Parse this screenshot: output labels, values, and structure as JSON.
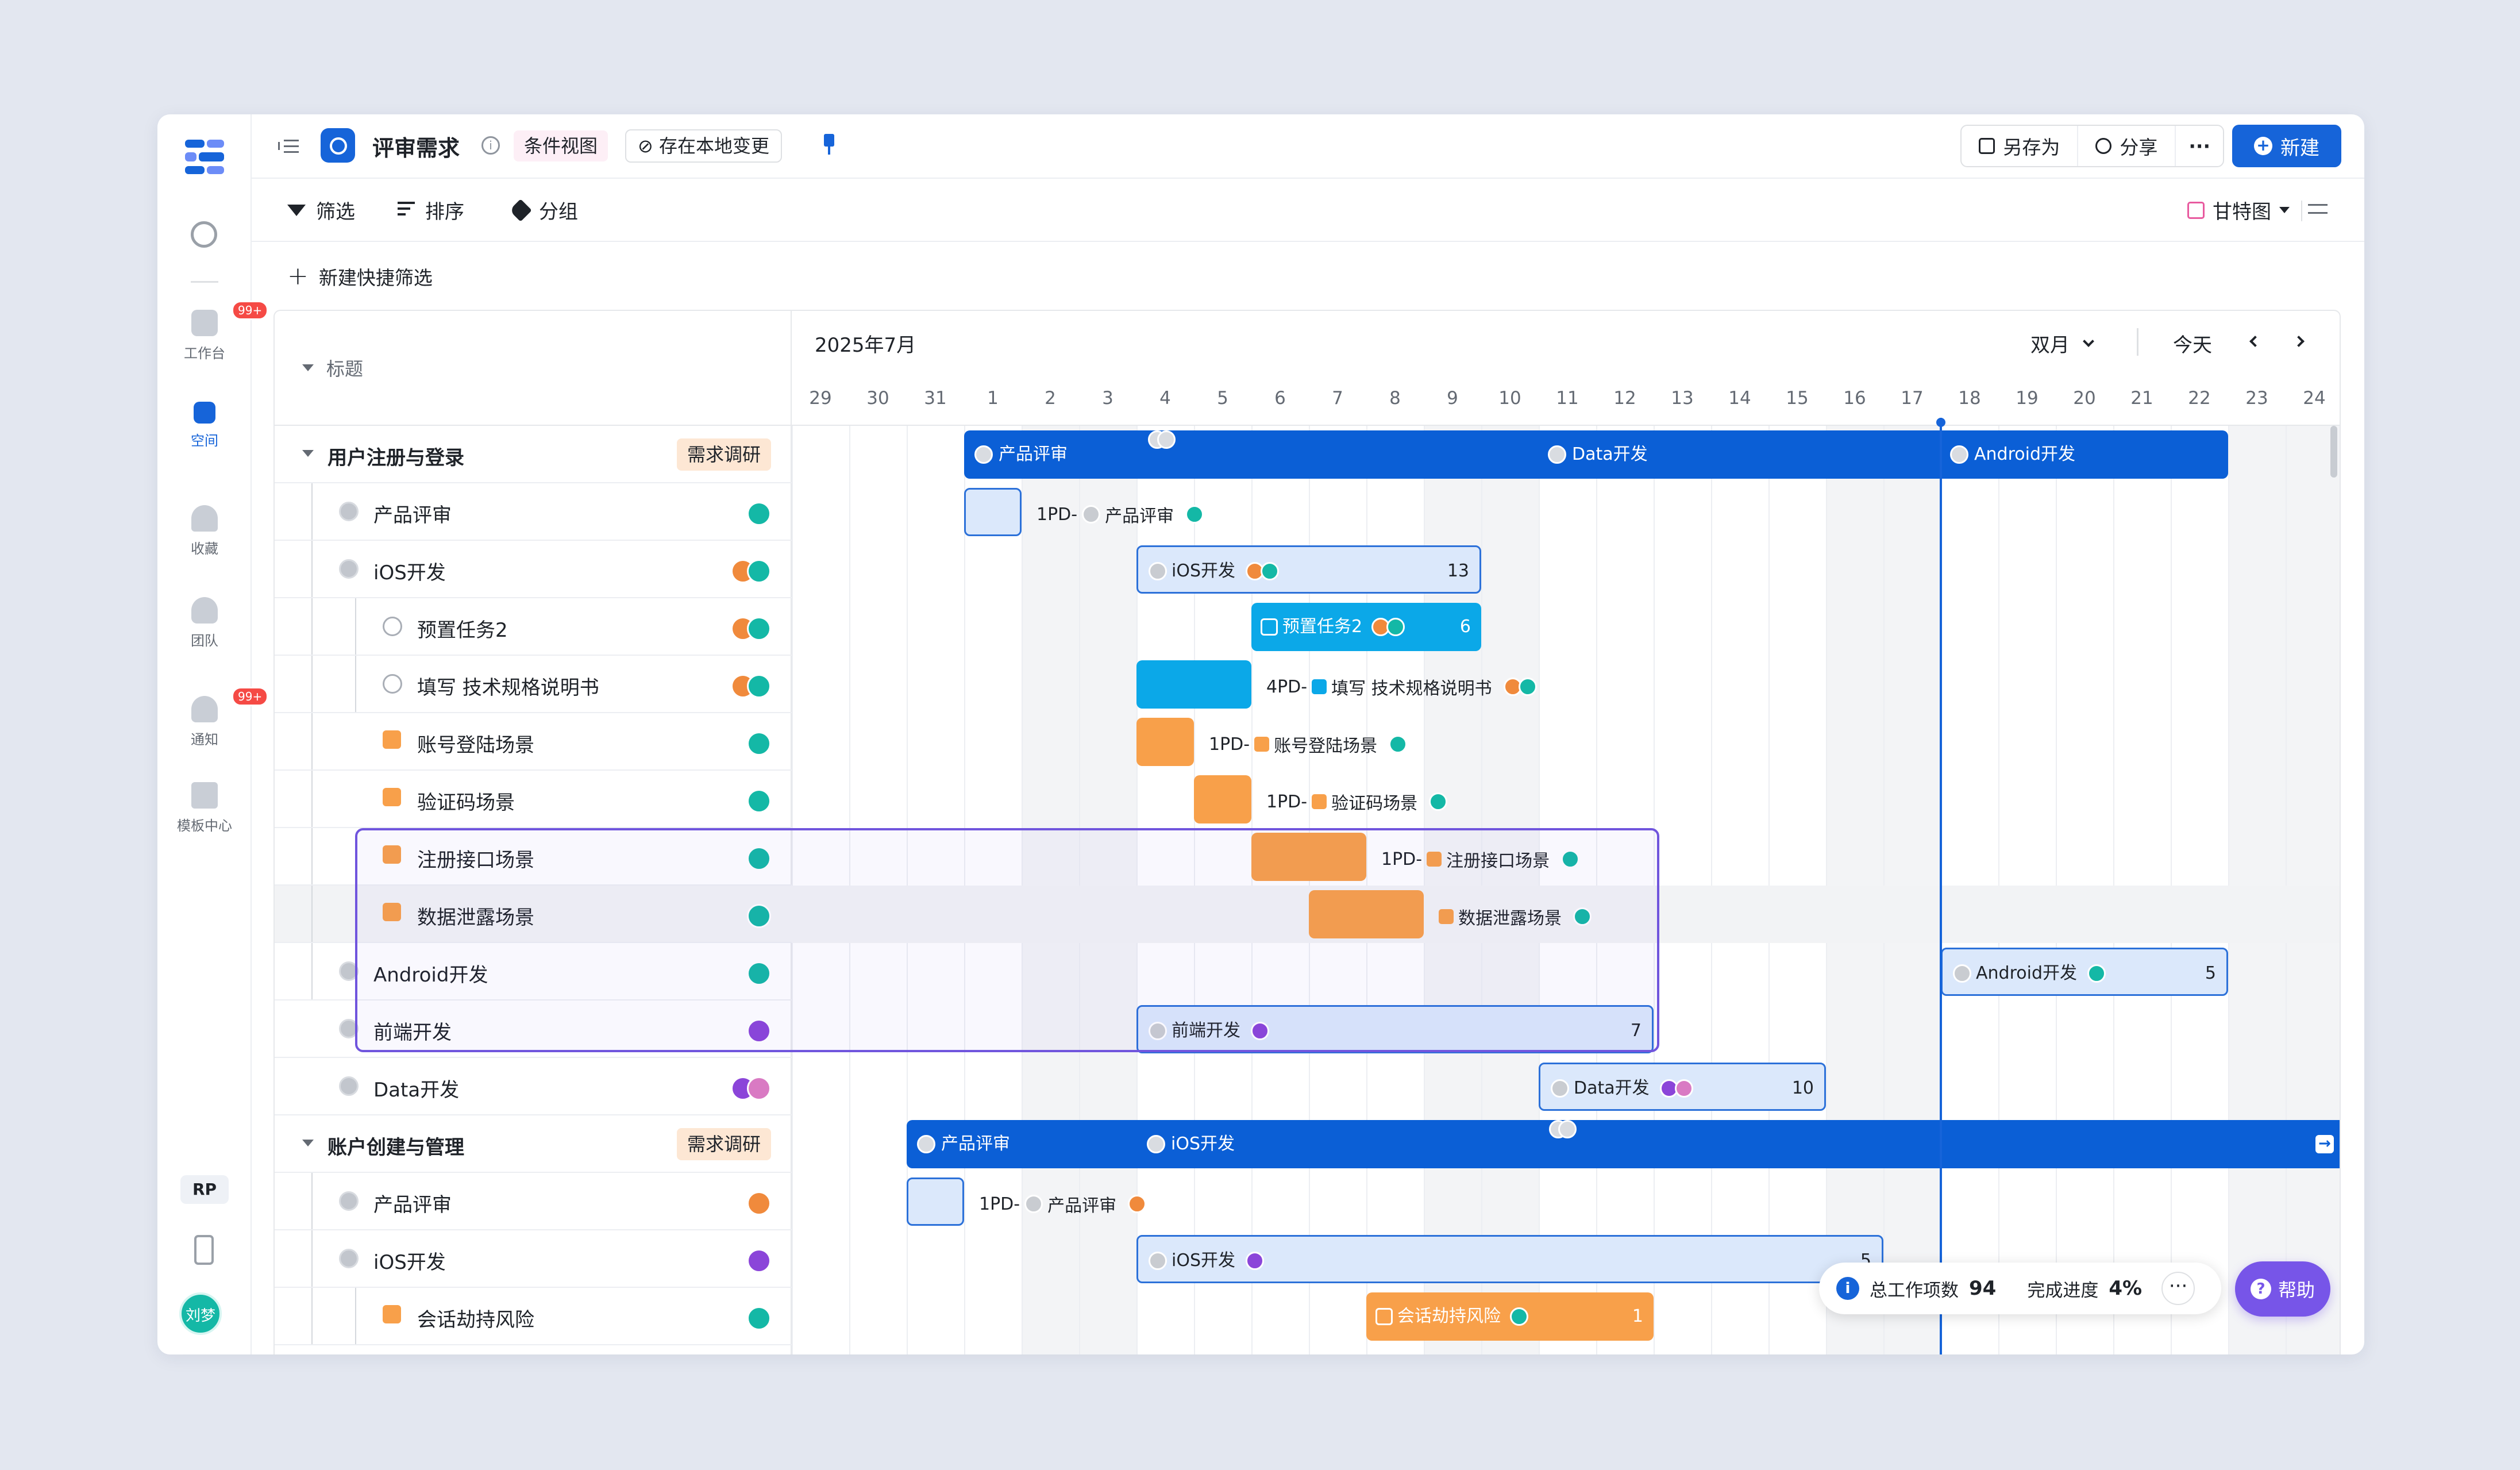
{
  "rail": {
    "items": [
      {
        "label": "工作台",
        "badge": "99+"
      },
      {
        "label": "空间"
      },
      {
        "label": "收藏"
      },
      {
        "label": "团队"
      },
      {
        "label": "通知",
        "badge": "99+"
      },
      {
        "label": "模板中心"
      }
    ],
    "workspace_chip": "RP",
    "user_avatar": "刘梦"
  },
  "header": {
    "title": "评审需求",
    "view_chip": "条件视图",
    "save_chip": "存在本地变更",
    "save_as": "另存为",
    "share": "分享",
    "more": "···",
    "new_button": "新建"
  },
  "toolbar": {
    "filter": "筛选",
    "sort": "排序",
    "group": "分组",
    "view_switch": "甘特图"
  },
  "quick_filter": "新建快捷筛选",
  "gantt": {
    "title_header": "标题",
    "month": "2025年7月",
    "scale": "双月",
    "today": "今天",
    "days": [
      "29",
      "30",
      "31",
      "1",
      "2",
      "3",
      "4",
      "5",
      "6",
      "7",
      "8",
      "9",
      "10",
      "11",
      "12",
      "13",
      "14",
      "15",
      "16",
      "17",
      "18",
      "19",
      "20",
      "21",
      "22",
      "23",
      "24"
    ],
    "rows": [
      {
        "title": "用户注册与登录",
        "tag": "需求调研"
      },
      {
        "title": "产品评审"
      },
      {
        "title": "iOS开发"
      },
      {
        "title": "预置任务2"
      },
      {
        "title": "填写 技术规格说明书"
      },
      {
        "title": "账号登陆场景"
      },
      {
        "title": "验证码场景"
      },
      {
        "title": "注册接口场景"
      },
      {
        "title": "数据泄露场景"
      },
      {
        "title": "Android开发"
      },
      {
        "title": "前端开发"
      },
      {
        "title": "Data开发"
      },
      {
        "title": "账户创建与管理",
        "tag": "需求调研"
      },
      {
        "title": "产品评审"
      },
      {
        "title": "iOS开发"
      },
      {
        "title": "会话劫持风险"
      }
    ],
    "bars": {
      "g1_seg1": "产品评审",
      "g1_seg2": "Data开发",
      "g1_seg3": "Android开发",
      "r1": "1PD-",
      "r1_name": "产品评审",
      "r2": "iOS开发",
      "r2_count": "13",
      "r3": "预置任务2",
      "r3_count": "6",
      "r4": "4PD-",
      "r4_name": "填写 技术规格说明书",
      "r5": "1PD-",
      "r5_name": "账号登陆场景",
      "r6": "1PD-",
      "r6_name": "验证码场景",
      "r7": "1PD-",
      "r7_name": "注册接口场景",
      "r8_name": "数据泄露场景",
      "r9": "Android开发",
      "r9_count": "5",
      "r10": "前端开发",
      "r10_count": "7",
      "r11": "Data开发",
      "r11_count": "10",
      "g2_seg1": "产品评审",
      "g2_seg2": "iOS开发",
      "r13": "1PD-",
      "r13_name": "产品评审",
      "r14": "iOS开发",
      "r14_count": "5",
      "r15": "会话劫持风险",
      "r15_count": "1"
    }
  },
  "summary": {
    "total_label": "总工作项数",
    "total": "94",
    "progress_label": "完成进度",
    "progress": "4%",
    "more": "···"
  },
  "help": "帮助",
  "colors": {
    "primary": "#1664d9",
    "orange": "#f8a04a",
    "teal": "#0ba8e8",
    "purple": "#7755e8"
  }
}
